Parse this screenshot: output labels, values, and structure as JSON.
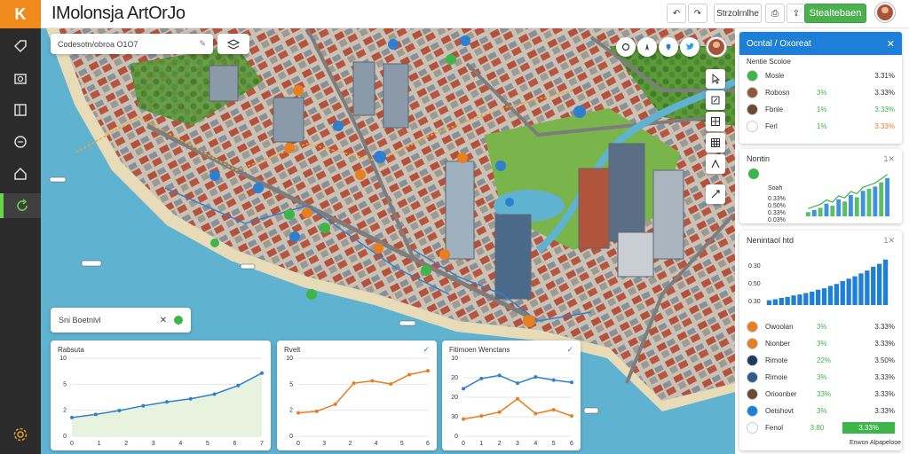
{
  "app": {
    "title": "IMolonsja ArtOrJo"
  },
  "topbar": {
    "btn1_label": "",
    "btn2_label": "Strzolrnlhe",
    "btn3_label": "",
    "primary_label": "Stealtebaen"
  },
  "map_search": {
    "placeholder": "Codesotn/obroa O1O7",
    "clear": "✎"
  },
  "map_search2": {
    "placeholder": "Sni Boetnlvl"
  },
  "charts": [
    {
      "title": "Rabsuta",
      "color": "#2f7fd0",
      "chart_data": {
        "type": "area",
        "x_ticks": [
          "0",
          "1",
          "2",
          "3",
          "4",
          "5",
          "6",
          "7"
        ],
        "y_ticks": [
          "0",
          "2",
          "5",
          "10"
        ],
        "values": [
          2.4,
          2.8,
          3.3,
          3.9,
          4.4,
          4.8,
          5.4,
          6.5,
          8.1
        ]
      }
    },
    {
      "title": "Rvelt",
      "color": "#e67e22",
      "chart_data": {
        "type": "line",
        "x_ticks": [
          "0",
          "3",
          "2",
          "4",
          "5",
          "6"
        ],
        "y_ticks": [
          "0",
          "2",
          "5",
          "10"
        ],
        "values": [
          3.0,
          3.2,
          4.1,
          6.8,
          7.1,
          6.7,
          7.9,
          8.4
        ]
      }
    },
    {
      "title": "Fitimoen Wenctans",
      "color": "#2f7fd0",
      "chart_data": {
        "type": "line",
        "x_ticks": [
          "0",
          "1",
          "2",
          "3",
          "4",
          "5",
          "6"
        ],
        "y_ticks": [
          "0",
          "30",
          "20",
          "20",
          "10"
        ],
        "series": [
          {
            "color": "#2f7fd0",
            "values": [
              6.1,
              7.4,
              7.8,
              6.8,
              7.6,
              7.2,
              6.9
            ]
          },
          {
            "color": "#e67e22",
            "values": [
              2.2,
              2.6,
              3.1,
              4.8,
              2.9,
              3.4,
              2.6
            ]
          }
        ]
      }
    }
  ],
  "panel1": {
    "title": "Ocntal / Oxoreat",
    "subtitle": "Nentie Scoloe",
    "rows": [
      {
        "name": "Mosle",
        "pct": "",
        "value": "3.31%",
        "icon_color": "#3cb54a",
        "value_color": "#333333"
      },
      {
        "name": "Robosn",
        "pct": "3%",
        "value": "3.33%",
        "icon_color": "#8c5a3a",
        "value_color": "#333333"
      },
      {
        "name": "Fbnie",
        "pct": "1%",
        "value": "3.33%",
        "icon_color": "#6b4a30",
        "value_color": "#3cb54a"
      },
      {
        "name": "Ferl",
        "pct": "1%",
        "value": "3.33%",
        "icon_color": "#ffffff",
        "value_color": "#e67e22"
      }
    ]
  },
  "panel2": {
    "title": "Nontin",
    "label": "Soah",
    "y_labels": [
      "0.33%",
      "0.50%",
      "0.33%",
      "0.03%"
    ],
    "chart_data": {
      "type": "bar+line",
      "values": [
        1,
        1.5,
        2,
        3,
        2.5,
        4,
        3.5,
        5,
        4.5,
        6,
        6.5,
        7,
        8,
        9
      ]
    }
  },
  "panel3": {
    "title": "Nenintaol htd",
    "y_labels": [
      "0.30",
      "0.50",
      "0.30"
    ],
    "chart_data": {
      "type": "bar",
      "values": [
        1,
        1.2,
        1.5,
        1.7,
        2,
        2.2,
        2.5,
        2.8,
        3.2,
        3.5,
        4,
        4.4,
        5,
        5.5,
        6,
        6.6,
        7.2,
        8,
        8.6,
        9.5
      ]
    },
    "rows": [
      {
        "name": "Owoolan",
        "pct": "3%",
        "value": "3.33%",
        "icon_color": "#e67e22",
        "value_color": "#333333"
      },
      {
        "name": "Nionber",
        "pct": "3%",
        "value": "3.33%",
        "icon_color": "#e67e22",
        "value_color": "#333333"
      },
      {
        "name": "Rimote",
        "pct": "22%",
        "value": "3.50%",
        "icon_color": "#1e3a5f",
        "value_color": "#333333"
      },
      {
        "name": "Rimoie",
        "pct": "3%",
        "value": "3.33%",
        "icon_color": "#2f5d8a",
        "value_color": "#333333"
      },
      {
        "name": "Orioonber",
        "pct": "33%",
        "value": "3.33%",
        "icon_color": "#6b4a30",
        "value_color": "#333333"
      },
      {
        "name": "Oetshovt",
        "pct": "3%",
        "value": "3.33%",
        "icon_color": "#1e7fd8",
        "value_color": "#333333"
      },
      {
        "name": "Fenol",
        "pct": "3.80",
        "value": "3.33%",
        "icon_color": "#ffffff",
        "value_color": "#ffffff"
      }
    ],
    "footer": "Enwon Alpapelooe"
  }
}
